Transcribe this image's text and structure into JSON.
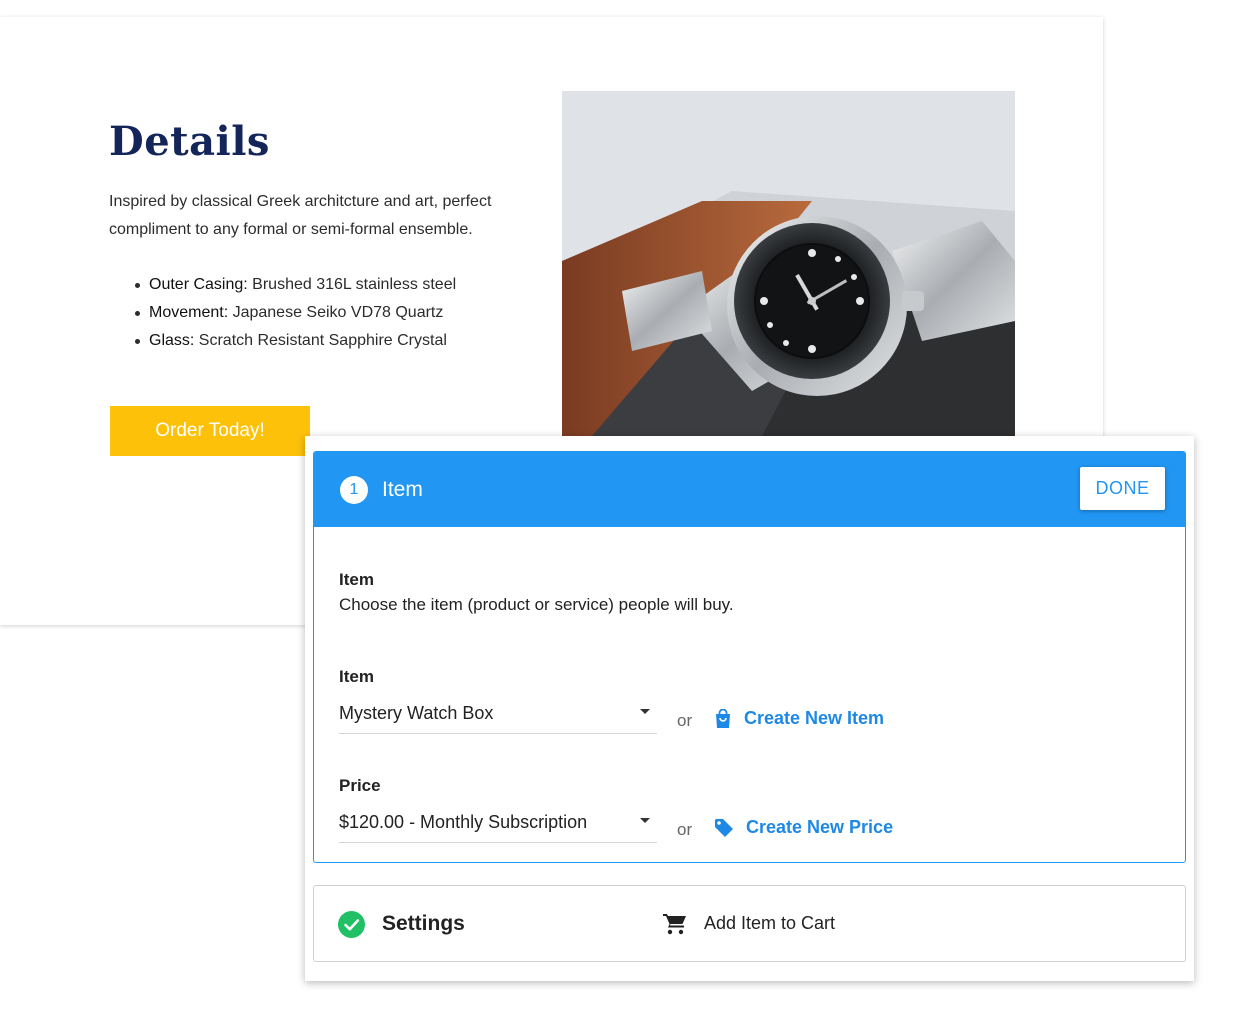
{
  "details": {
    "title": "Details",
    "description": "Inspired by classical Greek architcture and art, perfect compliment to any formal or semi-formal ensemble.",
    "features": [
      {
        "label": "Outer Casing:",
        "value": " Brushed 316L stainless steel"
      },
      {
        "label": "Movement:",
        "value": " Japanese Seiko VD78 Quartz"
      },
      {
        "label": "Glass:",
        "value": " Scratch Resistant Sapphire Crystal"
      }
    ],
    "order_button": "Order Today!",
    "image_icon": "watch-photo"
  },
  "builder": {
    "item_step": {
      "number": "1",
      "title": "Item",
      "done_label": "DONE",
      "heading": "Item",
      "description": "Choose the item (product or service) people will buy.",
      "item_field": {
        "label": "Item",
        "value": "Mystery Watch Box",
        "or": "or",
        "create_label": "Create New Item",
        "create_icon": "shopping-bag-icon"
      },
      "price_field": {
        "label": "Price",
        "value": "$120.00 - Monthly Subscription",
        "or": "or",
        "create_label": "Create New Price",
        "create_icon": "price-tag-icon"
      }
    },
    "settings_step": {
      "title": "Settings",
      "status_icon": "check-circle-icon",
      "action_icon": "cart-icon",
      "action_label": "Add Item to Cart"
    }
  },
  "colors": {
    "accent_blue": "#2196f3",
    "link_blue": "#1e88e5",
    "order_yellow": "#fec10a",
    "title_navy": "#14255a",
    "success_green": "#21c064"
  }
}
